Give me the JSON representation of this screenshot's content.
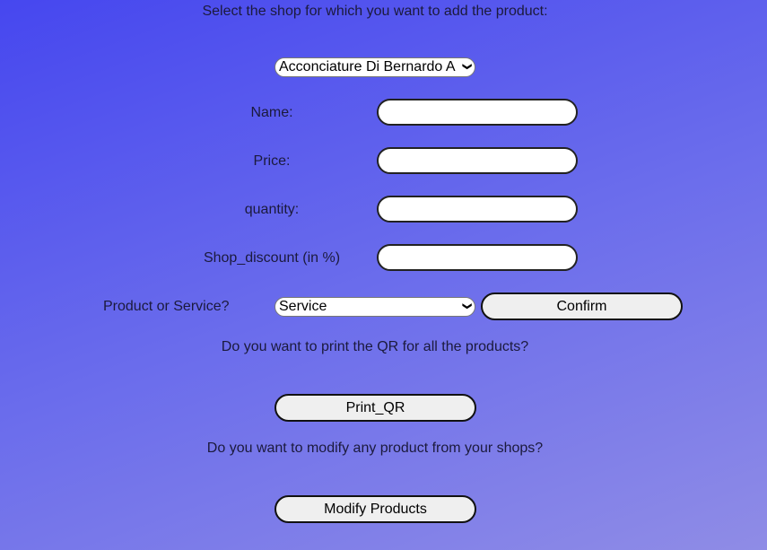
{
  "heading": "Select the shop for which you want to add the product:",
  "shop_select": {
    "value": "Acconciature Di Bernardo A"
  },
  "fields": [
    {
      "label": "Name:",
      "value": ""
    },
    {
      "label": "Price:",
      "value": ""
    },
    {
      "label": "quantity:",
      "value": ""
    },
    {
      "label": "Shop_discount (in %)",
      "value": ""
    }
  ],
  "type_label": "Product or Service?",
  "type_select": {
    "value": "Service"
  },
  "confirm_label": "Confirm",
  "qr_question": "Do you want to print the QR for all the products?",
  "print_qr_label": "Print_QR",
  "modify_question": "Do you want to modify any product from your shops?",
  "modify_label": "Modify Products"
}
